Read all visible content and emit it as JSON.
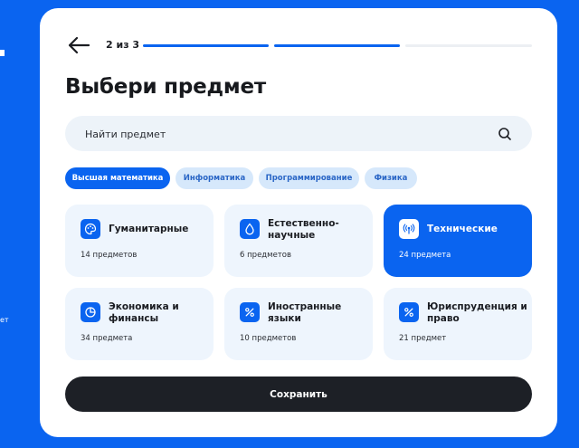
{
  "colors": {
    "accent": "#0a64f0",
    "progress_inactive": "#eceff3",
    "dark_button": "#1d2026",
    "chip_inactive_bg": "#d6e8fb",
    "tile_bg": "#eef5fd"
  },
  "background": {
    "side_text": "ет"
  },
  "header": {
    "back_icon": "arrow-left-icon",
    "step_label": "2 из 3",
    "progress": {
      "total_steps": 3,
      "filled_steps": 2
    }
  },
  "title": "Выбери предмет",
  "search": {
    "placeholder": "Найти предмет",
    "value": "",
    "icon": "search-icon"
  },
  "chips": [
    {
      "label": "Высшая математика",
      "active": true
    },
    {
      "label": "Информатика",
      "active": false
    },
    {
      "label": "Программирование",
      "active": false
    },
    {
      "label": "Физика",
      "active": false
    }
  ],
  "categories": [
    {
      "title": "Гуманитарные",
      "count": "14 предметов",
      "icon": "palette-icon",
      "selected": false
    },
    {
      "title": "Естественно-научные",
      "count": "6 предметов",
      "icon": "drop-icon",
      "selected": false
    },
    {
      "title": "Технические",
      "count": "24 предмета",
      "icon": "broadcast-icon",
      "selected": true
    },
    {
      "title": "Экономика и финансы",
      "count": "34 предмета",
      "icon": "pie-chart-icon",
      "selected": false
    },
    {
      "title": "Иностранные языки",
      "count": "10 предметов",
      "icon": "percent-icon",
      "selected": false
    },
    {
      "title": "Юриспруденция и право",
      "count": "21 предмет",
      "icon": "percent-icon",
      "selected": false
    }
  ],
  "save_label": "Сохранить"
}
